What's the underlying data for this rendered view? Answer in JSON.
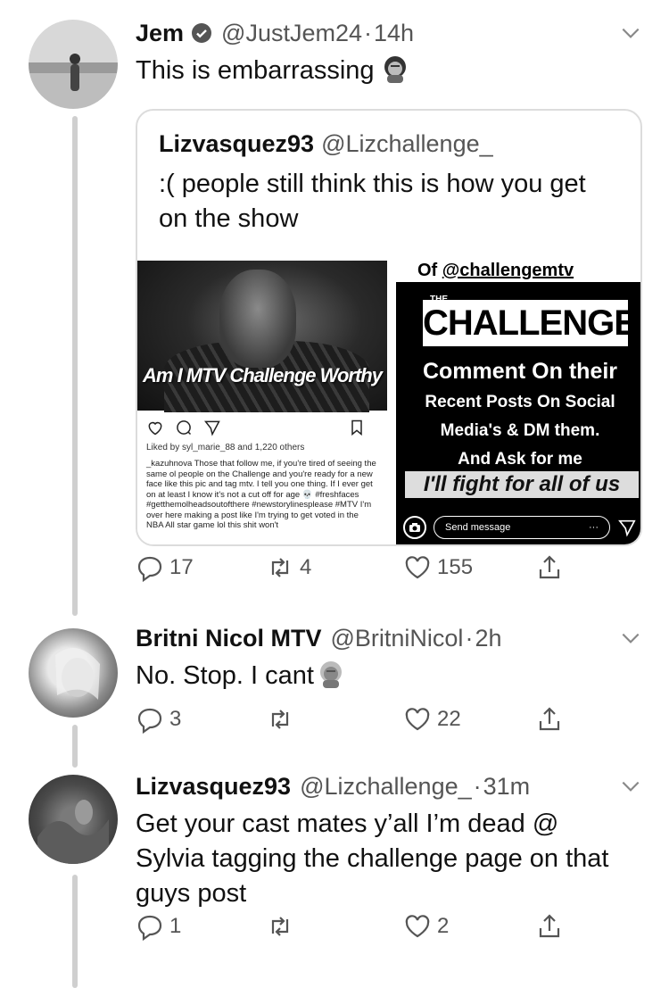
{
  "tweets": [
    {
      "name": "Jem",
      "verified": true,
      "handle": "@JustJem24",
      "separator": "·",
      "time": "14h",
      "text": "This is embarrassing",
      "emoji": "facepalm-woman-emoji",
      "quote": {
        "name": "Lizvasquez93",
        "handle": "@Lizchallenge_",
        "text": ":( people still think this is how you get on the show",
        "instagram_post": {
          "photo_caption": "Am I MTV Challenge Worthy",
          "likes": "Liked by syl_marie_88 and 1,220 others",
          "caption": "_kazuhnova Those that follow me, if you're tired of seeing the same ol people on the Challenge and you're ready for a new face like this pic and tag mtv. I tell you one thing. If I ever get on at least I know it's not a cut off for age 💀 #freshfaces #getthemolheadsoutofthere #newstorylinesplease #MTV I'm over here making a post like I'm trying to get voted in the NBA All star game lol this shit won't"
        },
        "story": {
          "top": "Of ",
          "top_tag": "@challengemtv",
          "logo_small": "THE",
          "logo": "CHALLENGE",
          "line1": "Comment On their",
          "line2": "Recent Posts On Social",
          "line3": "Media's & DM them.",
          "line4": "And Ask for me",
          "line5": "I'll fight for all of us",
          "send_placeholder": "Send message",
          "more": "···"
        }
      },
      "replies": "17",
      "retweets": "4",
      "likes": "155"
    },
    {
      "name": "Britni Nicol MTV",
      "verified": false,
      "handle": "@BritniNicol",
      "separator": "·",
      "time": "2h",
      "text": "No. Stop. I cant",
      "emoji": "facepalm-woman-emoji",
      "replies": "3",
      "retweets": "",
      "likes": "22"
    },
    {
      "name": "Lizvasquez93",
      "verified": false,
      "handle": "@Lizchallenge_",
      "separator": "·",
      "time": "31m",
      "text": "Get your cast mates y’all I’m dead @ Sylvia tagging the challenge page on that guys post",
      "replies": "1",
      "retweets": "",
      "likes": "2"
    }
  ],
  "colors": {
    "text": "#111111",
    "muted": "#555555",
    "line": "#cfcfcf"
  }
}
